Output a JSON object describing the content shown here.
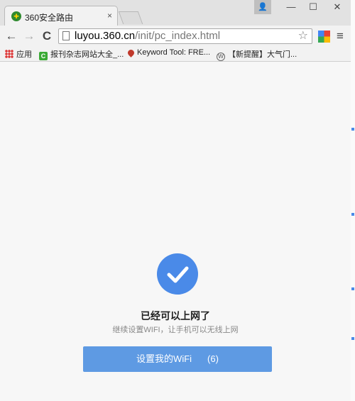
{
  "tab": {
    "title": "360安全路由",
    "close_label": "×"
  },
  "window_controls": {
    "profile": "👤",
    "minimize": "—",
    "maximize": "☐",
    "close": "✕"
  },
  "toolbar": {
    "back": "←",
    "forward": "→",
    "reload": "C",
    "url_host": "luyou.360.cn",
    "url_path": "/init/pc_index.html",
    "star": "☆",
    "menu": "≡"
  },
  "bookmarks": [
    {
      "label": "应用",
      "icon": "apps-grid-icon"
    },
    {
      "label": "报刊杂志网站大全_...",
      "icon": "c-favicon-icon"
    },
    {
      "label": "Keyword Tool: FRE...",
      "icon": "keyword-tool-icon"
    },
    {
      "label": "【新提醒】大气门...",
      "icon": "wordpress-icon"
    }
  ],
  "content": {
    "title": "已经可以上网了",
    "subtitle": "继续设置WIFI，让手机可以无线上网",
    "button_label": "设置我的WiFi",
    "button_count": "(6)"
  },
  "colors": {
    "accent": "#4a8ae8",
    "button": "#5e9ae3"
  }
}
